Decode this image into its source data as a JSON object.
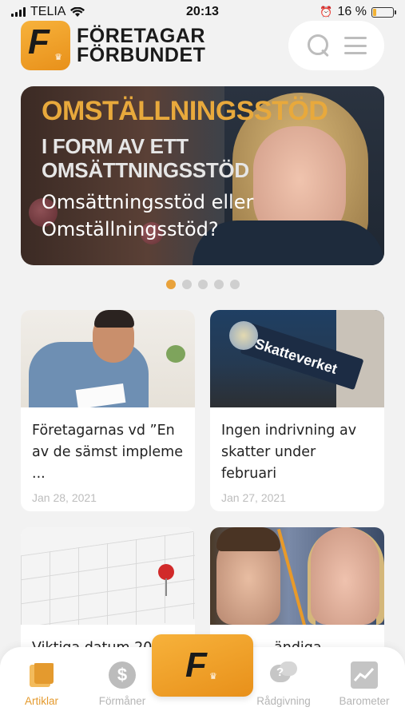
{
  "status_bar": {
    "carrier": "TELIA",
    "time": "20:13",
    "battery_percent": "16 %",
    "battery_level": 0.16
  },
  "header": {
    "logo_letter": "F",
    "logo_line1": "FÖRETAGAR",
    "logo_line2": "FÖRBUNDET",
    "search_icon": "search-icon",
    "menu_icon": "hamburger-menu-icon"
  },
  "hero": {
    "kicker": "OMSTÄLLNINGSSTÖD",
    "subline1": "I FORM AV ETT",
    "subline2": "OMSÄTTNINGSSTÖD",
    "title": "Omsättningsstöd eller Omställningsstöd?"
  },
  "carousel": {
    "count": 5,
    "active_index": 0
  },
  "articles": [
    {
      "title": "Företagarnas vd ”En av de sämst impleme ...",
      "date": "Jan 28, 2021"
    },
    {
      "title": "Ingen indrivning av skatter under februari",
      "date": "Jan 27, 2021",
      "sign_text": "Skatteverket"
    },
    {
      "title": "Viktiga datum 20",
      "date": ""
    },
    {
      "title": "ändiga",
      "date": ""
    }
  ],
  "tabbar": {
    "tabs": [
      {
        "label": "Artiklar",
        "icon": "articles-icon",
        "active": true
      },
      {
        "label": "Förmåner",
        "icon": "dollar-coin-icon",
        "active": false
      },
      {
        "label": "Rådgivning",
        "icon": "chat-question-icon",
        "active": false
      },
      {
        "label": "Barometer",
        "icon": "chart-icon",
        "active": false
      }
    ],
    "center_letter": "F"
  },
  "colors": {
    "accent": "#e49a2e",
    "inactive": "#b5b5b5",
    "background": "#f2f2f2"
  }
}
